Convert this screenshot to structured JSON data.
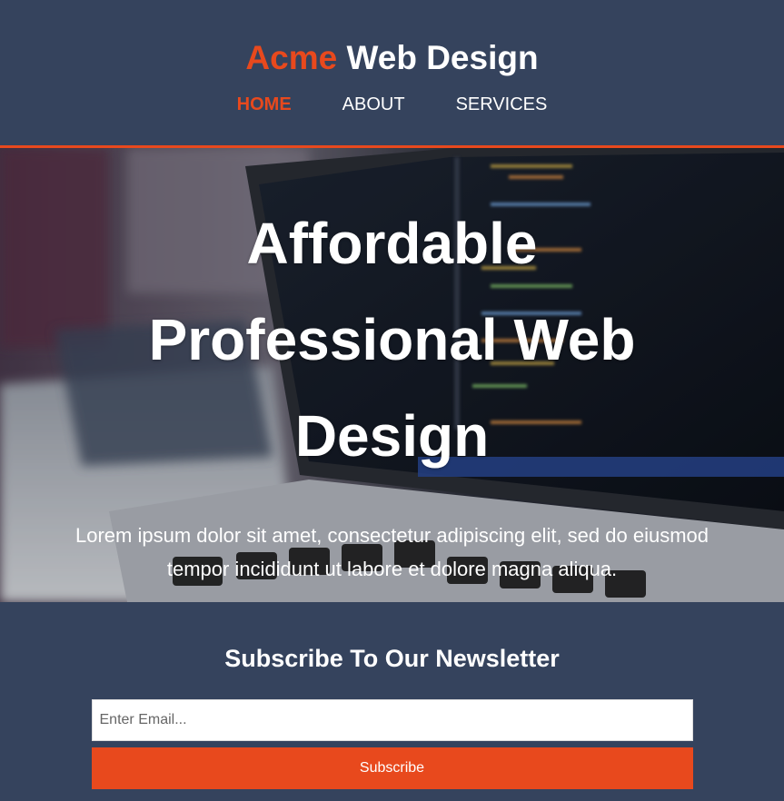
{
  "header": {
    "logo_accent": "Acme",
    "logo_rest": " Web Design",
    "nav": [
      "HOME",
      "ABOUT",
      "SERVICES"
    ],
    "active_nav": "HOME"
  },
  "showcase": {
    "heading": "Affordable Professional Web Design",
    "text": "Lorem ipsum dolor sit amet, consectetur adipiscing elit, sed do eiusmod tempor incididunt ut labore et dolore magna aliqua."
  },
  "newsletter": {
    "heading": "Subscribe To Our Newsletter",
    "email_placeholder": "Enter Email...",
    "button_label": "Subscribe"
  },
  "colors": {
    "accent": "#e8491d",
    "background": "#35435d"
  }
}
